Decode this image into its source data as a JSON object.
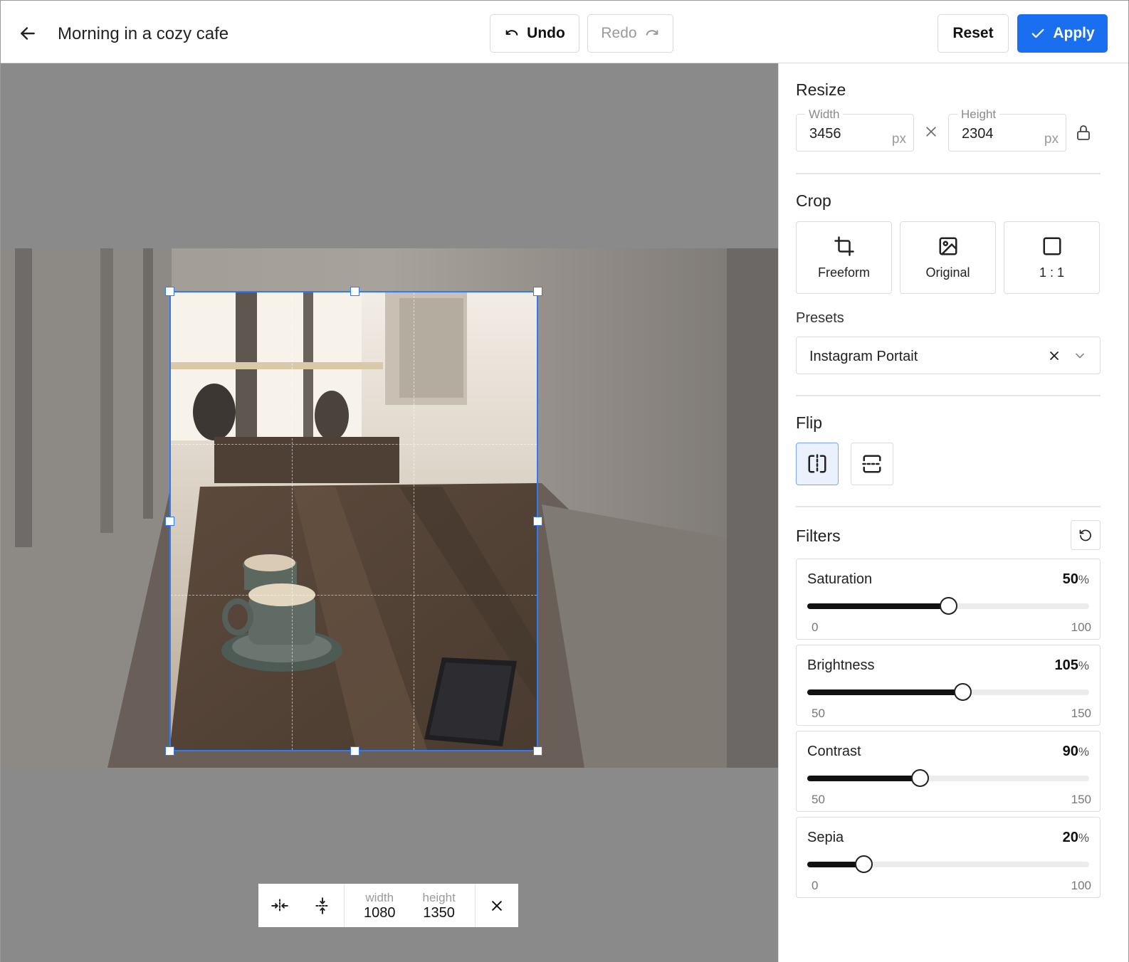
{
  "header": {
    "title": "Morning in a cozy cafe",
    "undo_label": "Undo",
    "redo_label": "Redo",
    "reset_label": "Reset",
    "apply_label": "Apply",
    "accent_color": "#1a6ef0"
  },
  "crop_toolbox": {
    "width_label": "width",
    "width_value": "1080",
    "height_label": "height",
    "height_value": "1350",
    "icons": [
      "expand-horizontal-icon",
      "expand-vertical-icon",
      "close-icon"
    ]
  },
  "resize": {
    "title": "Resize",
    "width_label": "Width",
    "width_value": "3456",
    "height_label": "Height",
    "height_value": "2304",
    "unit": "px"
  },
  "crop": {
    "title": "Crop",
    "options": [
      {
        "label": "Freeform",
        "icon": "crop-icon"
      },
      {
        "label": "Original",
        "icon": "image-icon"
      },
      {
        "label": "1 : 1",
        "icon": "square-icon"
      }
    ],
    "presets_label": "Presets",
    "preset_value": "Instagram Portait"
  },
  "flip": {
    "title": "Flip",
    "options": [
      {
        "name": "flip-horizontal",
        "active": true
      },
      {
        "name": "flip-vertical",
        "active": false
      }
    ]
  },
  "filters": {
    "title": "Filters",
    "items": [
      {
        "name": "Saturation",
        "value": "50",
        "unit": "%",
        "min": "0",
        "max": "100"
      },
      {
        "name": "Brightness",
        "value": "105",
        "unit": "%",
        "min": "50",
        "max": "150"
      },
      {
        "name": "Contrast",
        "value": "90",
        "unit": "%",
        "min": "50",
        "max": "150"
      },
      {
        "name": "Sepia",
        "value": "20",
        "unit": "%",
        "min": "0",
        "max": "100"
      }
    ]
  }
}
